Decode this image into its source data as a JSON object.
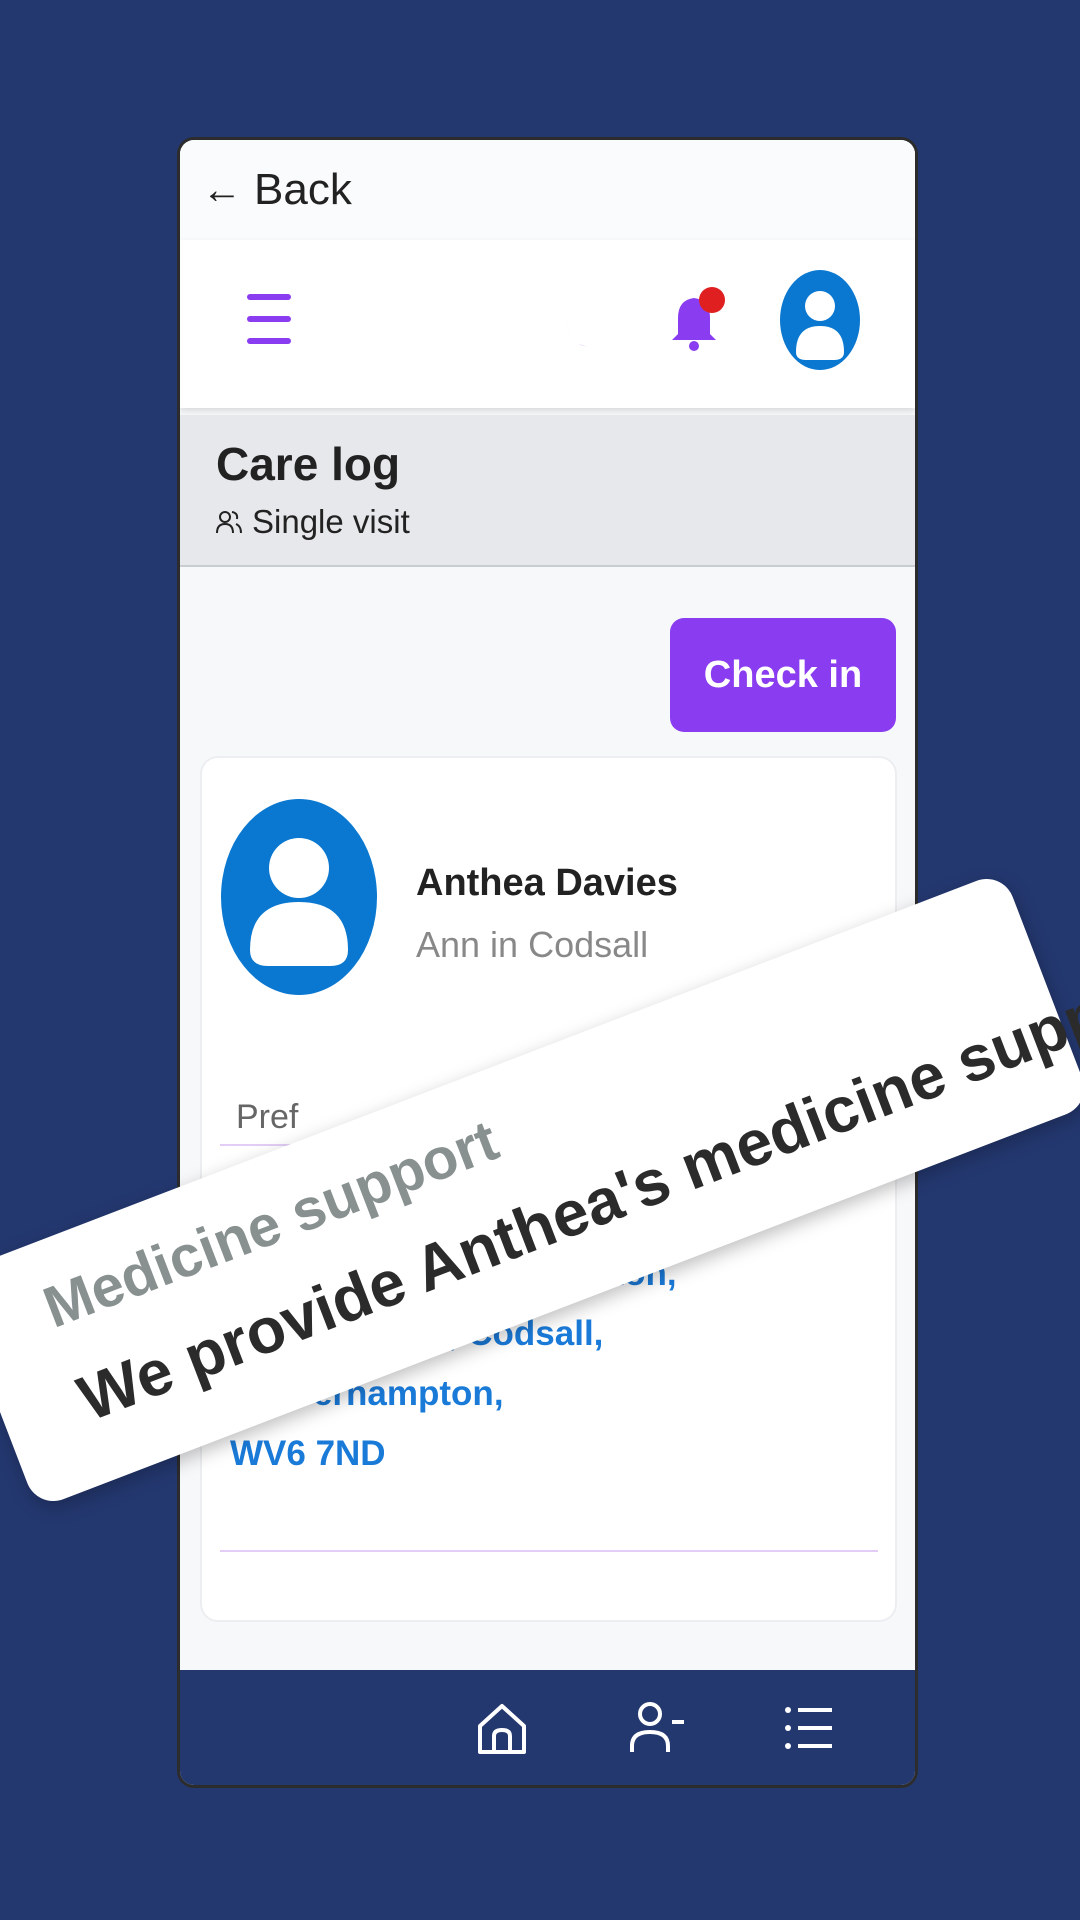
{
  "nav": {
    "back_label": "Back"
  },
  "header": {
    "menu_icon": "hamburger-menu-icon",
    "theme_icon": "moon-icon",
    "notifications_icon": "bell-icon",
    "profile_icon": "user-avatar-icon"
  },
  "page": {
    "title": "Care log",
    "visit_type": "Single visit"
  },
  "actions": {
    "check_in_label": "Check in"
  },
  "client": {
    "name": "Anthea Davies",
    "alias": "Ann in Codsall",
    "preferred_label_partial": "Pref",
    "address_line1": "…cton Cl, Wolverhampton,",
    "address_line2": "Staffordshire, Codsall, Wolverhampton,",
    "address_line3": "WV6 7ND"
  },
  "overlay": {
    "title": "Medicine support",
    "body": "We provide Anthea's medicine support"
  },
  "bottom_nav": {
    "items": [
      "home-icon",
      "user-minus-icon",
      "list-icon"
    ]
  },
  "colors": {
    "background": "#243870",
    "accent": "#8a3cf0",
    "link_blue": "#1a7ad8",
    "notification_dot": "#e02020",
    "avatar_blue": "#0a78d0"
  }
}
